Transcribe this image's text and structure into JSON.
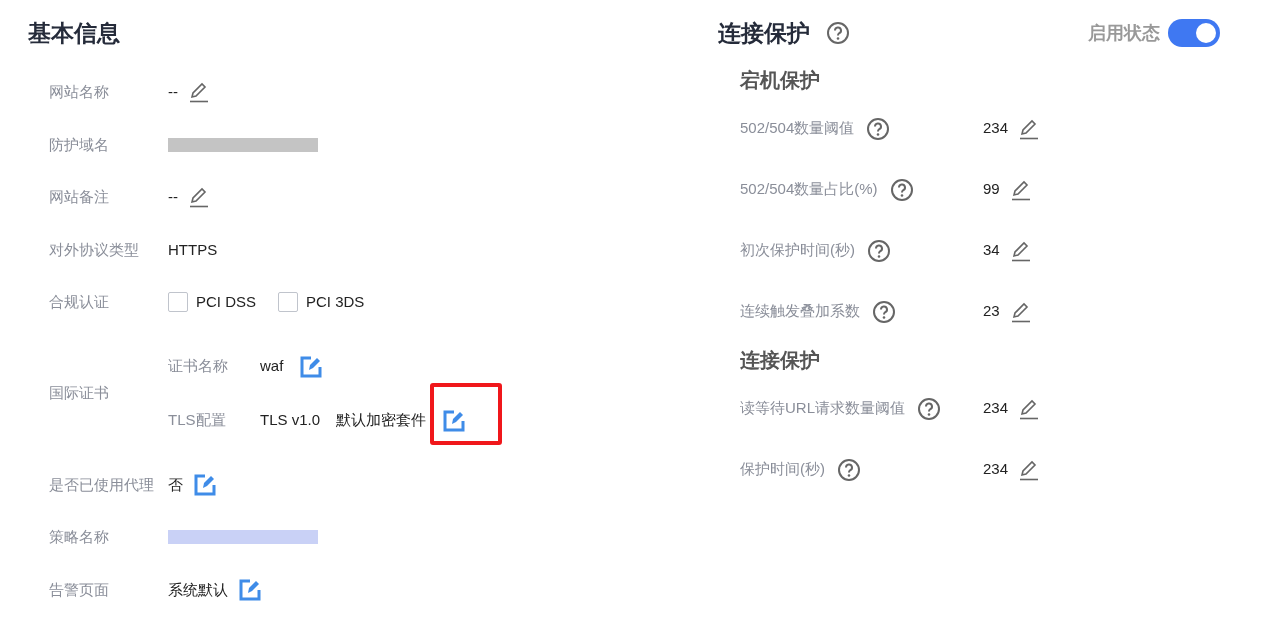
{
  "basic_info": {
    "title": "基本信息",
    "rows": [
      {
        "kind": "text",
        "label": "网站名称",
        "value": "--",
        "edit": {
          "kind": "line"
        }
      },
      {
        "kind": "redacted",
        "label": "防护域名",
        "color": "#c4c4c4"
      },
      {
        "kind": "text",
        "label": "网站备注",
        "value": "--",
        "edit": {
          "kind": "line"
        }
      },
      {
        "kind": "text",
        "label": "对外协议类型",
        "value": "HTTPS"
      },
      {
        "kind": "checkboxes",
        "label": "合规认证",
        "options": [
          {
            "label": "PCI DSS",
            "checked": false
          },
          {
            "label": "PCI 3DS",
            "checked": false
          }
        ]
      },
      {
        "kind": "certificate",
        "label": "国际证书",
        "sub_rows": [
          {
            "label": "证书名称",
            "values": [
              "waf"
            ],
            "edit": {
              "kind": "boxed"
            },
            "highlighted": false
          },
          {
            "label": "TLS配置",
            "values": [
              "TLS v1.0",
              "默认加密套件"
            ],
            "edit": {
              "kind": "boxed"
            },
            "highlighted": true
          }
        ]
      },
      {
        "kind": "text",
        "label": "是否已使用代理",
        "value": "否",
        "edit": {
          "kind": "boxed"
        }
      },
      {
        "kind": "redacted",
        "label": "策略名称",
        "color": "#c9d1f6"
      },
      {
        "kind": "text",
        "label": "告警页面",
        "value": "系统默认",
        "edit": {
          "kind": "boxed"
        }
      }
    ]
  },
  "connection_protection": {
    "title": "连接保护",
    "status_label": "启用状态",
    "enabled": true,
    "sections": [
      {
        "title": "宕机保护",
        "rows": [
          {
            "label": "502/504数量阈值",
            "value": "234"
          },
          {
            "label": "502/504数量占比(%)",
            "value": "99"
          },
          {
            "label": "初次保护时间(秒)",
            "value": "34"
          },
          {
            "label": "连续触发叠加系数",
            "value": "23"
          }
        ]
      },
      {
        "title": "连接保护",
        "rows": [
          {
            "label": "读等待URL请求数量阈值",
            "value": "234"
          },
          {
            "label": "保护时间(秒)",
            "value": "234"
          }
        ]
      }
    ]
  }
}
